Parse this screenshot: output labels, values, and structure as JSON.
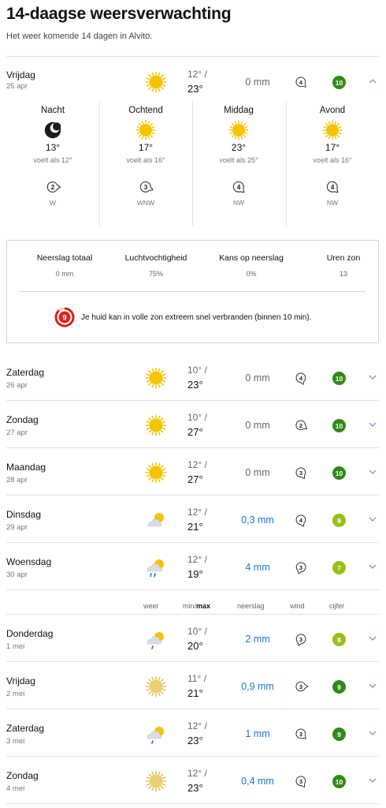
{
  "header": {
    "title": "14-daagse weersverwachting",
    "subtitle": "Het weer komende 14 dagen in Alvito."
  },
  "colors": {
    "sun": "#f5c400",
    "score_dark_green": "#2f8a17",
    "score_green": "#4f9e1e",
    "score_yellow_green": "#9bbe1a",
    "precip_blue": "#1a73d9",
    "uv_red": "#d9251f"
  },
  "today": {
    "parts": [
      {
        "name": "Nacht",
        "icon": "moon-icon",
        "temp": "13°",
        "feels": "voelt als 12°",
        "wind": "2",
        "dir": "W",
        "wind_rot": 90
      },
      {
        "name": "Ochtend",
        "icon": "sun-icon",
        "temp": "17°",
        "feels": "voelt als 16°",
        "wind": "3",
        "dir": "WNW",
        "wind_rot": 112
      },
      {
        "name": "Middag",
        "icon": "sun-icon",
        "temp": "23°",
        "feels": "voelt als 25°",
        "wind": "4",
        "dir": "NW",
        "wind_rot": 135
      },
      {
        "name": "Avond",
        "icon": "sun-icon",
        "temp": "17°",
        "feels": "voelt als 16°",
        "wind": "4",
        "dir": "NW",
        "wind_rot": 135
      }
    ],
    "stats": [
      {
        "label": "Neerslag totaal",
        "value": "0 mm"
      },
      {
        "label": "Luchtvochtigheid",
        "value": "75%"
      },
      {
        "label": "Kans op neerslag",
        "value": "0%"
      },
      {
        "label": "Uren zon",
        "value": "13"
      }
    ],
    "uv": {
      "index": "9",
      "text": "Je huid kan in volle zon extreem snel verbranden (binnen 10 min)."
    }
  },
  "legend": {
    "weer": "weer",
    "min": "min/",
    "max": "max",
    "neerslag": "neerslag",
    "wind": "wind",
    "cijfer": "cijfer"
  },
  "days": [
    {
      "name": "Vrijdag",
      "date": "25 apr",
      "icon": "sun-icon",
      "min": "12° /",
      "max": "23°",
      "precip": "0 mm",
      "wet": false,
      "wind": "4",
      "wind_rot": 135,
      "score": "10",
      "score_color": "#2f8a17",
      "expanded": true
    },
    {
      "name": "Zaterdag",
      "date": "26 apr",
      "icon": "sun-icon",
      "min": "10° /",
      "max": "23°",
      "precip": "0 mm",
      "wet": false,
      "wind": "4",
      "wind_rot": 160,
      "score": "10",
      "score_color": "#2f8a17",
      "expanded": false
    },
    {
      "name": "Zondag",
      "date": "27 apr",
      "icon": "sun-icon",
      "min": "10° /",
      "max": "27°",
      "precip": "0 mm",
      "wet": false,
      "wind": "2",
      "wind_rot": 120,
      "score": "10",
      "score_color": "#2f8a17",
      "expanded": false
    },
    {
      "name": "Maandag",
      "date": "28 apr",
      "icon": "sun-icon",
      "min": "12° /",
      "max": "27°",
      "precip": "0 mm",
      "wet": false,
      "wind": "3",
      "wind_rot": 150,
      "score": "10",
      "score_color": "#2f8a17",
      "expanded": false
    },
    {
      "name": "Dinsdag",
      "date": "29 apr",
      "icon": "partly-cloudy-icon",
      "min": "12° /",
      "max": "21°",
      "precip": "0,3 mm",
      "wet": true,
      "wind": "4",
      "wind_rot": 160,
      "score": "8",
      "score_color": "#9bbe1a",
      "expanded": false
    },
    {
      "name": "Woensdag",
      "date": "30 apr",
      "icon": "rain-shower-icon",
      "min": "12° /",
      "max": "19°",
      "precip": "4 mm",
      "wet": true,
      "wind": "3",
      "wind_rot": 200,
      "score": "7",
      "score_color": "#9bbe1a",
      "expanded": false
    },
    {
      "name": "Donderdag",
      "date": "1 mei",
      "icon": "light-shower-icon",
      "min": "10° /",
      "max": "20°",
      "precip": "2 mm",
      "wet": true,
      "wind": "3",
      "wind_rot": 200,
      "score": "8",
      "score_color": "#9bbe1a",
      "expanded": false
    },
    {
      "name": "Vrijdag",
      "date": "2 mei",
      "icon": "hazy-sun-icon",
      "min": "11° /",
      "max": "21°",
      "precip": "0,9 mm",
      "wet": true,
      "wind": "3",
      "wind_rot": 90,
      "score": "9",
      "score_color": "#2f8a17",
      "expanded": false
    },
    {
      "name": "Zaterdag",
      "date": "3 mei",
      "icon": "light-shower-icon",
      "min": "12° /",
      "max": "23°",
      "precip": "1 mm",
      "wet": true,
      "wind": "3",
      "wind_rot": 135,
      "score": "9",
      "score_color": "#2f8a17",
      "expanded": false
    },
    {
      "name": "Zondag",
      "date": "4 mei",
      "icon": "hazy-sun-icon",
      "min": "12° /",
      "max": "23°",
      "precip": "0,4 mm",
      "wet": true,
      "wind": "3",
      "wind_rot": 150,
      "score": "10",
      "score_color": "#2f8a17",
      "expanded": false
    }
  ]
}
